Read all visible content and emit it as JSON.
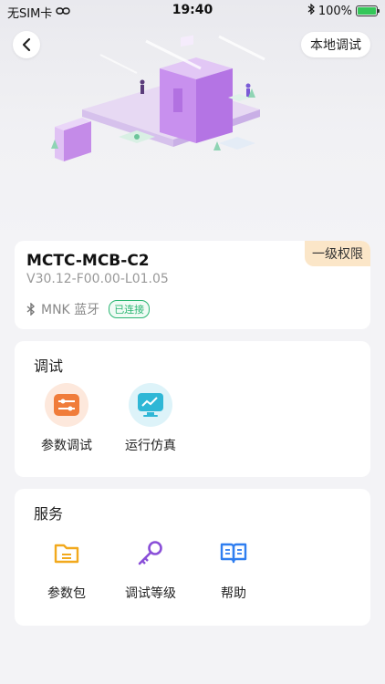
{
  "status_bar": {
    "carrier": "无SIM卡",
    "time": "19:40",
    "battery": "100%",
    "battery_level": 1.0
  },
  "header": {
    "local_debug_label": "本地调试"
  },
  "device": {
    "name": "MCTC-MCB-C2",
    "version": "V30.12-F00.00-L01.05",
    "permission": "一级权限",
    "bluetooth_name": "MNK 蓝牙",
    "connection_status": "已连接"
  },
  "debug_section": {
    "title": "调试",
    "items": [
      {
        "label": "参数调试",
        "icon": "sliders-icon"
      },
      {
        "label": "运行仿真",
        "icon": "monitor-chart-icon"
      }
    ]
  },
  "service_section": {
    "title": "服务",
    "items": [
      {
        "label": "参数包",
        "icon": "folder-icon"
      },
      {
        "label": "调试等级",
        "icon": "key-icon"
      },
      {
        "label": "帮助",
        "icon": "book-icon"
      }
    ]
  },
  "colors": {
    "accent_orange": "#f07c3a",
    "accent_cyan": "#2fb7d6",
    "accent_purple": "#8a4fd8",
    "accent_blue": "#2f7ef0",
    "accent_yellow": "#f2a91d",
    "connected_green": "#2bb673",
    "permission_bg": "#fbe6c8"
  }
}
